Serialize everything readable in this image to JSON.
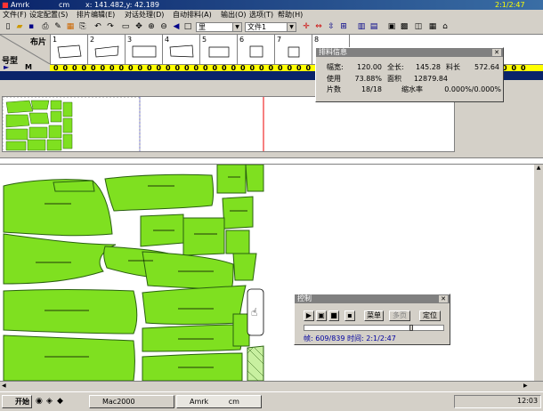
{
  "window": {
    "title": "Amrk",
    "unit": "cm",
    "coords": "x: 141.482,y:  42.189",
    "clock": "2:1/2:47"
  },
  "menu": [
    "文件(F)",
    "设定配置(S)",
    "排片编辑(E)",
    "对话处理(D)",
    "自动排料(A)",
    "输出(O)",
    "选项(T)",
    "帮助(H)"
  ],
  "toolbar": {
    "layer_combo": "里",
    "file_combo": "文件1"
  },
  "pieces_header": {
    "corner_top": "布片",
    "corner_bottom": "号型",
    "row_label": "M",
    "numbers": [
      "1",
      "2",
      "3",
      "4",
      "5",
      "6",
      "7",
      "8"
    ],
    "counts": [
      "0",
      "0",
      "0",
      "0",
      "0",
      "0",
      "0",
      "0",
      "0",
      "0",
      "0",
      "0",
      "0",
      "0",
      "0",
      "0",
      "0",
      "0",
      "0",
      "0",
      "0",
      "0",
      "0",
      "0",
      "0",
      "0",
      "0",
      "0",
      "0",
      "0",
      "0",
      "0",
      "0",
      "0",
      "0",
      "0",
      "0",
      "0",
      "0",
      "0",
      "0",
      "0",
      "0",
      "0",
      "0",
      "0",
      "0",
      "0",
      "0",
      "0",
      "0"
    ]
  },
  "info_dialog": {
    "title": "排料信息",
    "width_label": "幅宽:",
    "width_value": "120.00",
    "length_label": "全长:",
    "length_value": "145.28",
    "material_label": "料长",
    "material_value": "572.64",
    "usage_label": "使用",
    "usage_value": "73.88%",
    "area_label": "面积",
    "area_value": "12879.84",
    "pieces_label": "片数",
    "pieces_value": "18/18",
    "shrink_label": "缩水率",
    "shrink_value": "0.000%/0.000%"
  },
  "control_dialog": {
    "title": "控制",
    "menu_button": "菜单",
    "multi_button": "多页",
    "locate_button": "定位",
    "status": "帧: 609/839 时间: 2:1/2:47"
  },
  "taskbar": {
    "start": "开始",
    "task1": "Mac2000",
    "task2": "Amrk",
    "task2_unit": "cm",
    "time": "12:03"
  },
  "colors": {
    "piece_fill": "#7fe020",
    "piece_stroke": "#2a6010",
    "title_bg": "#0a246a",
    "count_bar": "#ffff00"
  }
}
